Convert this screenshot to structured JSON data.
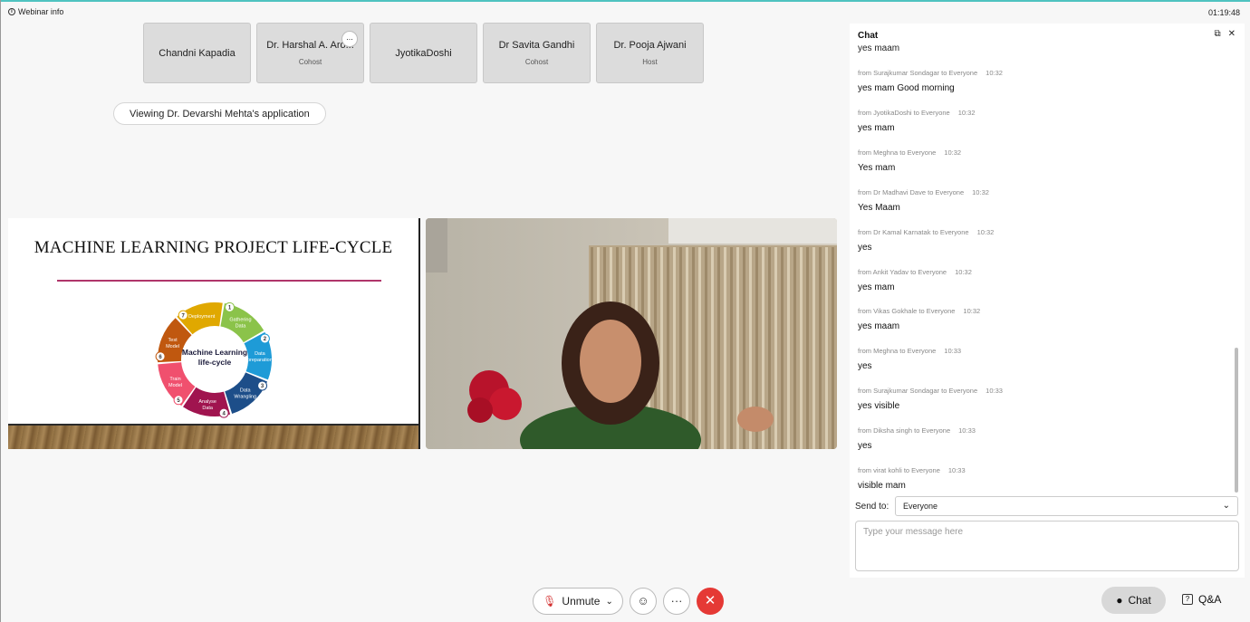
{
  "topbar": {
    "webinar_info": "Webinar info",
    "clock": "01:19:48"
  },
  "participants": [
    {
      "name": "Chandni Kapadia",
      "role": ""
    },
    {
      "name": "Dr. Harshal A. Aro...",
      "role": "Cohost"
    },
    {
      "name": "JyotikaDoshi",
      "role": ""
    },
    {
      "name": "Dr Savita Gandhi",
      "role": "Cohost"
    },
    {
      "name": "Dr. Pooja Ajwani",
      "role": "Host"
    }
  ],
  "participant_more": "...",
  "viewing": "Viewing Dr. Devarshi Mehta's application",
  "slide": {
    "title": "MACHINE LEARNING PROJECT LIFE-CYCLE",
    "center": [
      "Machine Learning",
      "life-cycle"
    ],
    "steps": [
      {
        "num": "1",
        "label": [
          "Gathering",
          "Data"
        ],
        "color": "#8bc34a"
      },
      {
        "num": "2",
        "label": [
          "Data",
          "preparation"
        ],
        "color": "#1e9bd7"
      },
      {
        "num": "3",
        "label": [
          "Data",
          "Wrangling"
        ],
        "color": "#1d4e89"
      },
      {
        "num": "4",
        "label": [
          "Analyse",
          "Data"
        ],
        "color": "#a0144f"
      },
      {
        "num": "5",
        "label": [
          "Train",
          "Model"
        ],
        "color": "#f0506e"
      },
      {
        "num": "6",
        "label": [
          "Test",
          "Model"
        ],
        "color": "#c0580f"
      },
      {
        "num": "7",
        "label": [
          "Deployment"
        ],
        "color": "#e0a800"
      }
    ]
  },
  "chat": {
    "title": "Chat",
    "top_partial": "yes maam",
    "messages": [
      {
        "from": "from Surajkumar Sondagar to Everyone",
        "time": "10:32",
        "text": "yes mam Good morning"
      },
      {
        "from": "from JyotikaDoshi to Everyone",
        "time": "10:32",
        "text": "yes mam"
      },
      {
        "from": "from Meghna to Everyone",
        "time": "10:32",
        "text": "Yes mam"
      },
      {
        "from": "from Dr Madhavi Dave to Everyone",
        "time": "10:32",
        "text": "Yes Maam"
      },
      {
        "from": "from Dr Kamal Karnatak to Everyone",
        "time": "10:32",
        "text": "yes"
      },
      {
        "from": "from Ankit Yadav to Everyone",
        "time": "10:32",
        "text": "yes mam"
      },
      {
        "from": "from Vikas Gokhale to Everyone",
        "time": "10:32",
        "text": "yes maam"
      },
      {
        "from": "from Meghna to Everyone",
        "time": "10:33",
        "text": "yes"
      },
      {
        "from": "from Surajkumar Sondagar to Everyone",
        "time": "10:33",
        "text": "yes visible"
      },
      {
        "from": "from Diksha singh to Everyone",
        "time": "10:33",
        "text": "yes"
      },
      {
        "from": "from virat kohli to Everyone",
        "time": "10:33",
        "text": "visible mam"
      }
    ],
    "send_to_label": "Send to:",
    "send_to_value": "Everyone",
    "input_placeholder": "Type your message here"
  },
  "controls": {
    "unmute": "Unmute",
    "more": "···",
    "end": "✕"
  },
  "bottom_right": {
    "chat": "Chat",
    "qa": "Q&A"
  }
}
